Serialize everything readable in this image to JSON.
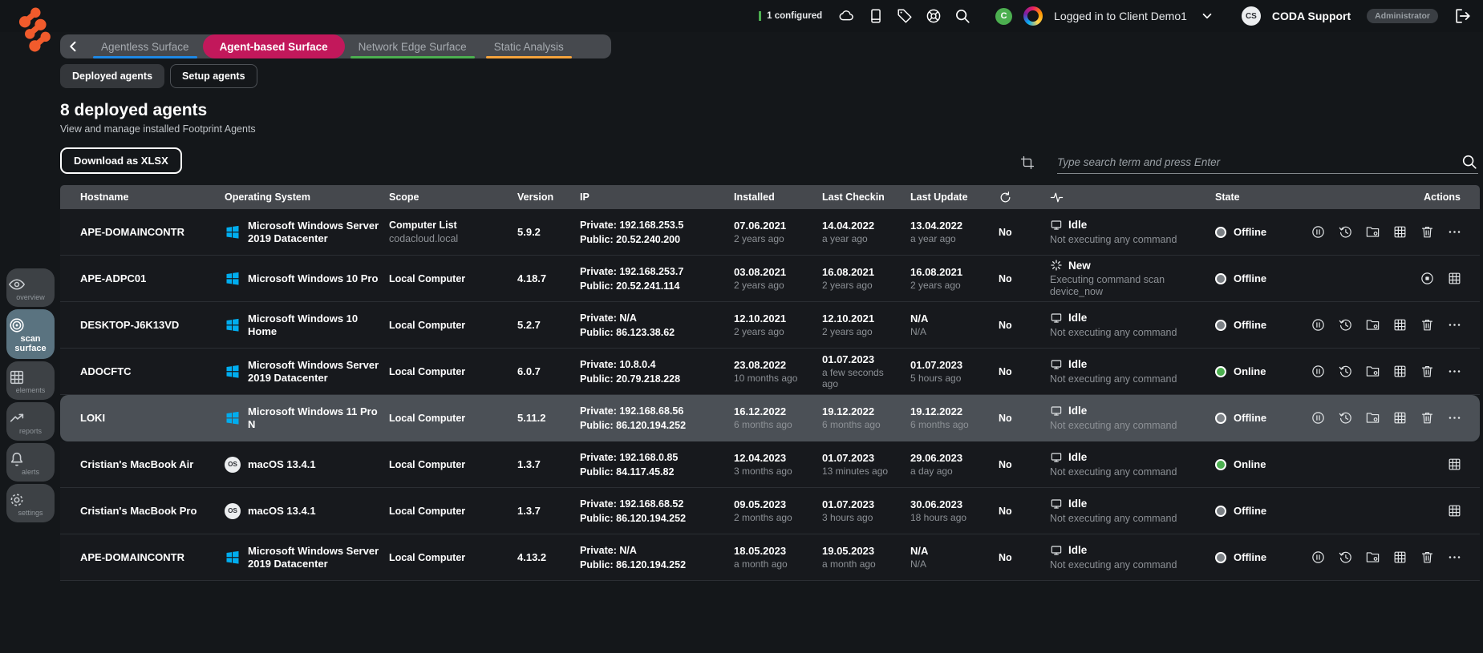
{
  "topbar": {
    "configured": "1 configured",
    "client_avatar_initial": "C",
    "client_label": "Logged in to Client Demo1",
    "account_initials": "CS",
    "account_name": "CODA Support",
    "role_badge": "Administrator",
    "icons": [
      "cloud-icon",
      "device-icon",
      "tag-icon",
      "support-wheel-icon",
      "search-icon",
      "chevron-down-icon",
      "logout-icon"
    ]
  },
  "tabs": [
    {
      "label": "Agentless Surface",
      "active": false,
      "underline_color": "#1e88e5"
    },
    {
      "label": "Agent-based Surface",
      "active": true,
      "underline_color": "#c2185b"
    },
    {
      "label": "Network Edge Surface",
      "active": false,
      "underline_color": "#4caf50"
    },
    {
      "label": "Static Analysis",
      "active": false,
      "underline_color": "#f5a33c"
    }
  ],
  "subtabs": [
    {
      "label": "Deployed agents",
      "active": true
    },
    {
      "label": "Setup agents",
      "active": false
    }
  ],
  "page": {
    "title": "8 deployed agents",
    "subtitle": "View and manage installed Footprint Agents",
    "download_button": "Download as XLSX",
    "search_placeholder": "Type search term and press Enter"
  },
  "icons": {
    "macos_badge": "OS",
    "header_icon_columns": [
      "auto-update-icon",
      "activity-pulse-icon"
    ],
    "row_action_icons": [
      "pause-circle-icon",
      "history-icon",
      "folder-scan-icon",
      "grid-icon",
      "trash-icon",
      "more-icon",
      "stop-circle-icon"
    ]
  },
  "colors": {
    "accent_pink": "#c2185b",
    "underline_blue": "#1e88e5",
    "underline_green": "#4caf50",
    "underline_orange": "#f5a33c",
    "online": "#4caf50",
    "offline": "#7c8186",
    "windows_blue": "#00adef",
    "logo_orange": "#f15b2c",
    "configured_bar": "#4caf50"
  },
  "sidebar": {
    "items": [
      {
        "label": "overview",
        "active": false
      },
      {
        "label": "scan surface",
        "active": true
      },
      {
        "label": "elements",
        "active": false
      },
      {
        "label": "reports",
        "active": false
      },
      {
        "label": "alerts",
        "active": false
      },
      {
        "label": "settings",
        "active": false
      }
    ]
  },
  "table": {
    "columns": [
      "Hostname",
      "Operating System",
      "Scope",
      "Version",
      "IP",
      "Installed",
      "Last Checkin",
      "Last Update",
      "",
      "",
      "State",
      "Actions"
    ],
    "rows": [
      {
        "variant": "",
        "hostname": "APE-DOMAINCONTR",
        "os_type": "windows",
        "os": "Microsoft Windows Server 2019 Datacenter",
        "scope": "Computer List",
        "scope_sub": "codacloud.local",
        "version": "5.9.2",
        "ip_private": "Private: 192.168.253.5",
        "ip_public": "Public: 20.52.240.200",
        "installed": "07.06.2021",
        "installed_ago": "2 years ago",
        "last_checkin": "14.04.2022",
        "last_checkin_ago": "a year ago",
        "last_update": "13.04.2022",
        "last_update_ago": "a year ago",
        "auto_update": "No",
        "activity_key": "idle",
        "activity": "Idle",
        "activity_desc": "Not executing any command",
        "state_key": "offline",
        "state": "Offline",
        "actions_set": "full"
      },
      {
        "variant": "",
        "hostname": "APE-ADPC01",
        "os_type": "windows",
        "os": "Microsoft Windows 10 Pro",
        "scope": "Local Computer",
        "scope_sub": "",
        "version": "4.18.7",
        "ip_private": "Private: 192.168.253.7",
        "ip_public": "Public: 20.52.241.114",
        "installed": "03.08.2021",
        "installed_ago": "2 years ago",
        "last_checkin": "16.08.2021",
        "last_checkin_ago": "2 years ago",
        "last_update": "16.08.2021",
        "last_update_ago": "2 years ago",
        "auto_update": "No",
        "activity_key": "new",
        "activity": "New",
        "activity_desc": "Executing command scan device_now",
        "state_key": "offline",
        "state": "Offline",
        "actions_set": "stop-grid"
      },
      {
        "variant": "",
        "hostname": "DESKTOP-J6K13VD",
        "os_type": "windows",
        "os": "Microsoft Windows 10 Home",
        "scope": "Local Computer",
        "scope_sub": "",
        "version": "5.2.7",
        "ip_private": "Private: N/A",
        "ip_public": "Public: 86.123.38.62",
        "installed": "12.10.2021",
        "installed_ago": "2 years ago",
        "last_checkin": "12.10.2021",
        "last_checkin_ago": "2 years ago",
        "last_update": "N/A",
        "last_update_ago": "N/A",
        "auto_update": "No",
        "activity_key": "idle",
        "activity": "Idle",
        "activity_desc": "Not executing any command",
        "state_key": "offline",
        "state": "Offline",
        "actions_set": "full"
      },
      {
        "variant": "",
        "hostname": "ADOCFTC",
        "os_type": "windows",
        "os": "Microsoft Windows Server 2019 Datacenter",
        "scope": "Local Computer",
        "scope_sub": "",
        "version": "6.0.7",
        "ip_private": "Private: 10.8.0.4",
        "ip_public": "Public: 20.79.218.228",
        "installed": "23.08.2022",
        "installed_ago": "10 months ago",
        "last_checkin": "01.07.2023",
        "last_checkin_ago": "a few seconds ago",
        "last_update": "01.07.2023",
        "last_update_ago": "5 hours ago",
        "auto_update": "No",
        "activity_key": "idle",
        "activity": "Idle",
        "activity_desc": "Not executing any command",
        "state_key": "online",
        "state": "Online",
        "actions_set": "full"
      },
      {
        "variant": "highlight",
        "hostname": "LOKI",
        "os_type": "windows",
        "os": "Microsoft Windows 11 Pro N",
        "scope": "Local Computer",
        "scope_sub": "",
        "version": "5.11.2",
        "ip_private": "Private: 192.168.68.56",
        "ip_public": "Public: 86.120.194.252",
        "installed": "16.12.2022",
        "installed_ago": "6 months ago",
        "last_checkin": "19.12.2022",
        "last_checkin_ago": "6 months ago",
        "last_update": "19.12.2022",
        "last_update_ago": "6 months ago",
        "auto_update": "No",
        "activity_key": "idle",
        "activity": "Idle",
        "activity_desc": "Not executing any command",
        "state_key": "offline",
        "state": "Offline",
        "actions_set": "full"
      },
      {
        "variant": "",
        "hostname": "Cristian's MacBook Air",
        "os_type": "macos",
        "os": "macOS 13.4.1",
        "scope": "Local Computer",
        "scope_sub": "",
        "version": "1.3.7",
        "ip_private": "Private: 192.168.0.85",
        "ip_public": "Public: 84.117.45.82",
        "installed": "12.04.2023",
        "installed_ago": "3 months ago",
        "last_checkin": "01.07.2023",
        "last_checkin_ago": "13 minutes ago",
        "last_update": "29.06.2023",
        "last_update_ago": "a day ago",
        "auto_update": "No",
        "activity_key": "idle",
        "activity": "Idle",
        "activity_desc": "Not executing any command",
        "state_key": "online",
        "state": "Online",
        "actions_set": "grid"
      },
      {
        "variant": "",
        "hostname": "Cristian's MacBook Pro",
        "os_type": "macos",
        "os": "macOS 13.4.1",
        "scope": "Local Computer",
        "scope_sub": "",
        "version": "1.3.7",
        "ip_private": "Private: 192.168.68.52",
        "ip_public": "Public: 86.120.194.252",
        "installed": "09.05.2023",
        "installed_ago": "2 months ago",
        "last_checkin": "01.07.2023",
        "last_checkin_ago": "3 hours ago",
        "last_update": "30.06.2023",
        "last_update_ago": "18 hours ago",
        "auto_update": "No",
        "activity_key": "idle",
        "activity": "Idle",
        "activity_desc": "Not executing any command",
        "state_key": "offline",
        "state": "Offline",
        "actions_set": "grid"
      },
      {
        "variant": "",
        "hostname": "APE-DOMAINCONTR",
        "os_type": "windows",
        "os": "Microsoft Windows Server 2019 Datacenter",
        "scope": "Local Computer",
        "scope_sub": "",
        "version": "4.13.2",
        "ip_private": "Private: N/A",
        "ip_public": "Public: 86.120.194.252",
        "installed": "18.05.2023",
        "installed_ago": "a month ago",
        "last_checkin": "19.05.2023",
        "last_checkin_ago": "a month ago",
        "last_update": "N/A",
        "last_update_ago": "N/A",
        "auto_update": "No",
        "activity_key": "idle",
        "activity": "Idle",
        "activity_desc": "Not executing any command",
        "state_key": "offline",
        "state": "Offline",
        "actions_set": "full"
      }
    ]
  }
}
